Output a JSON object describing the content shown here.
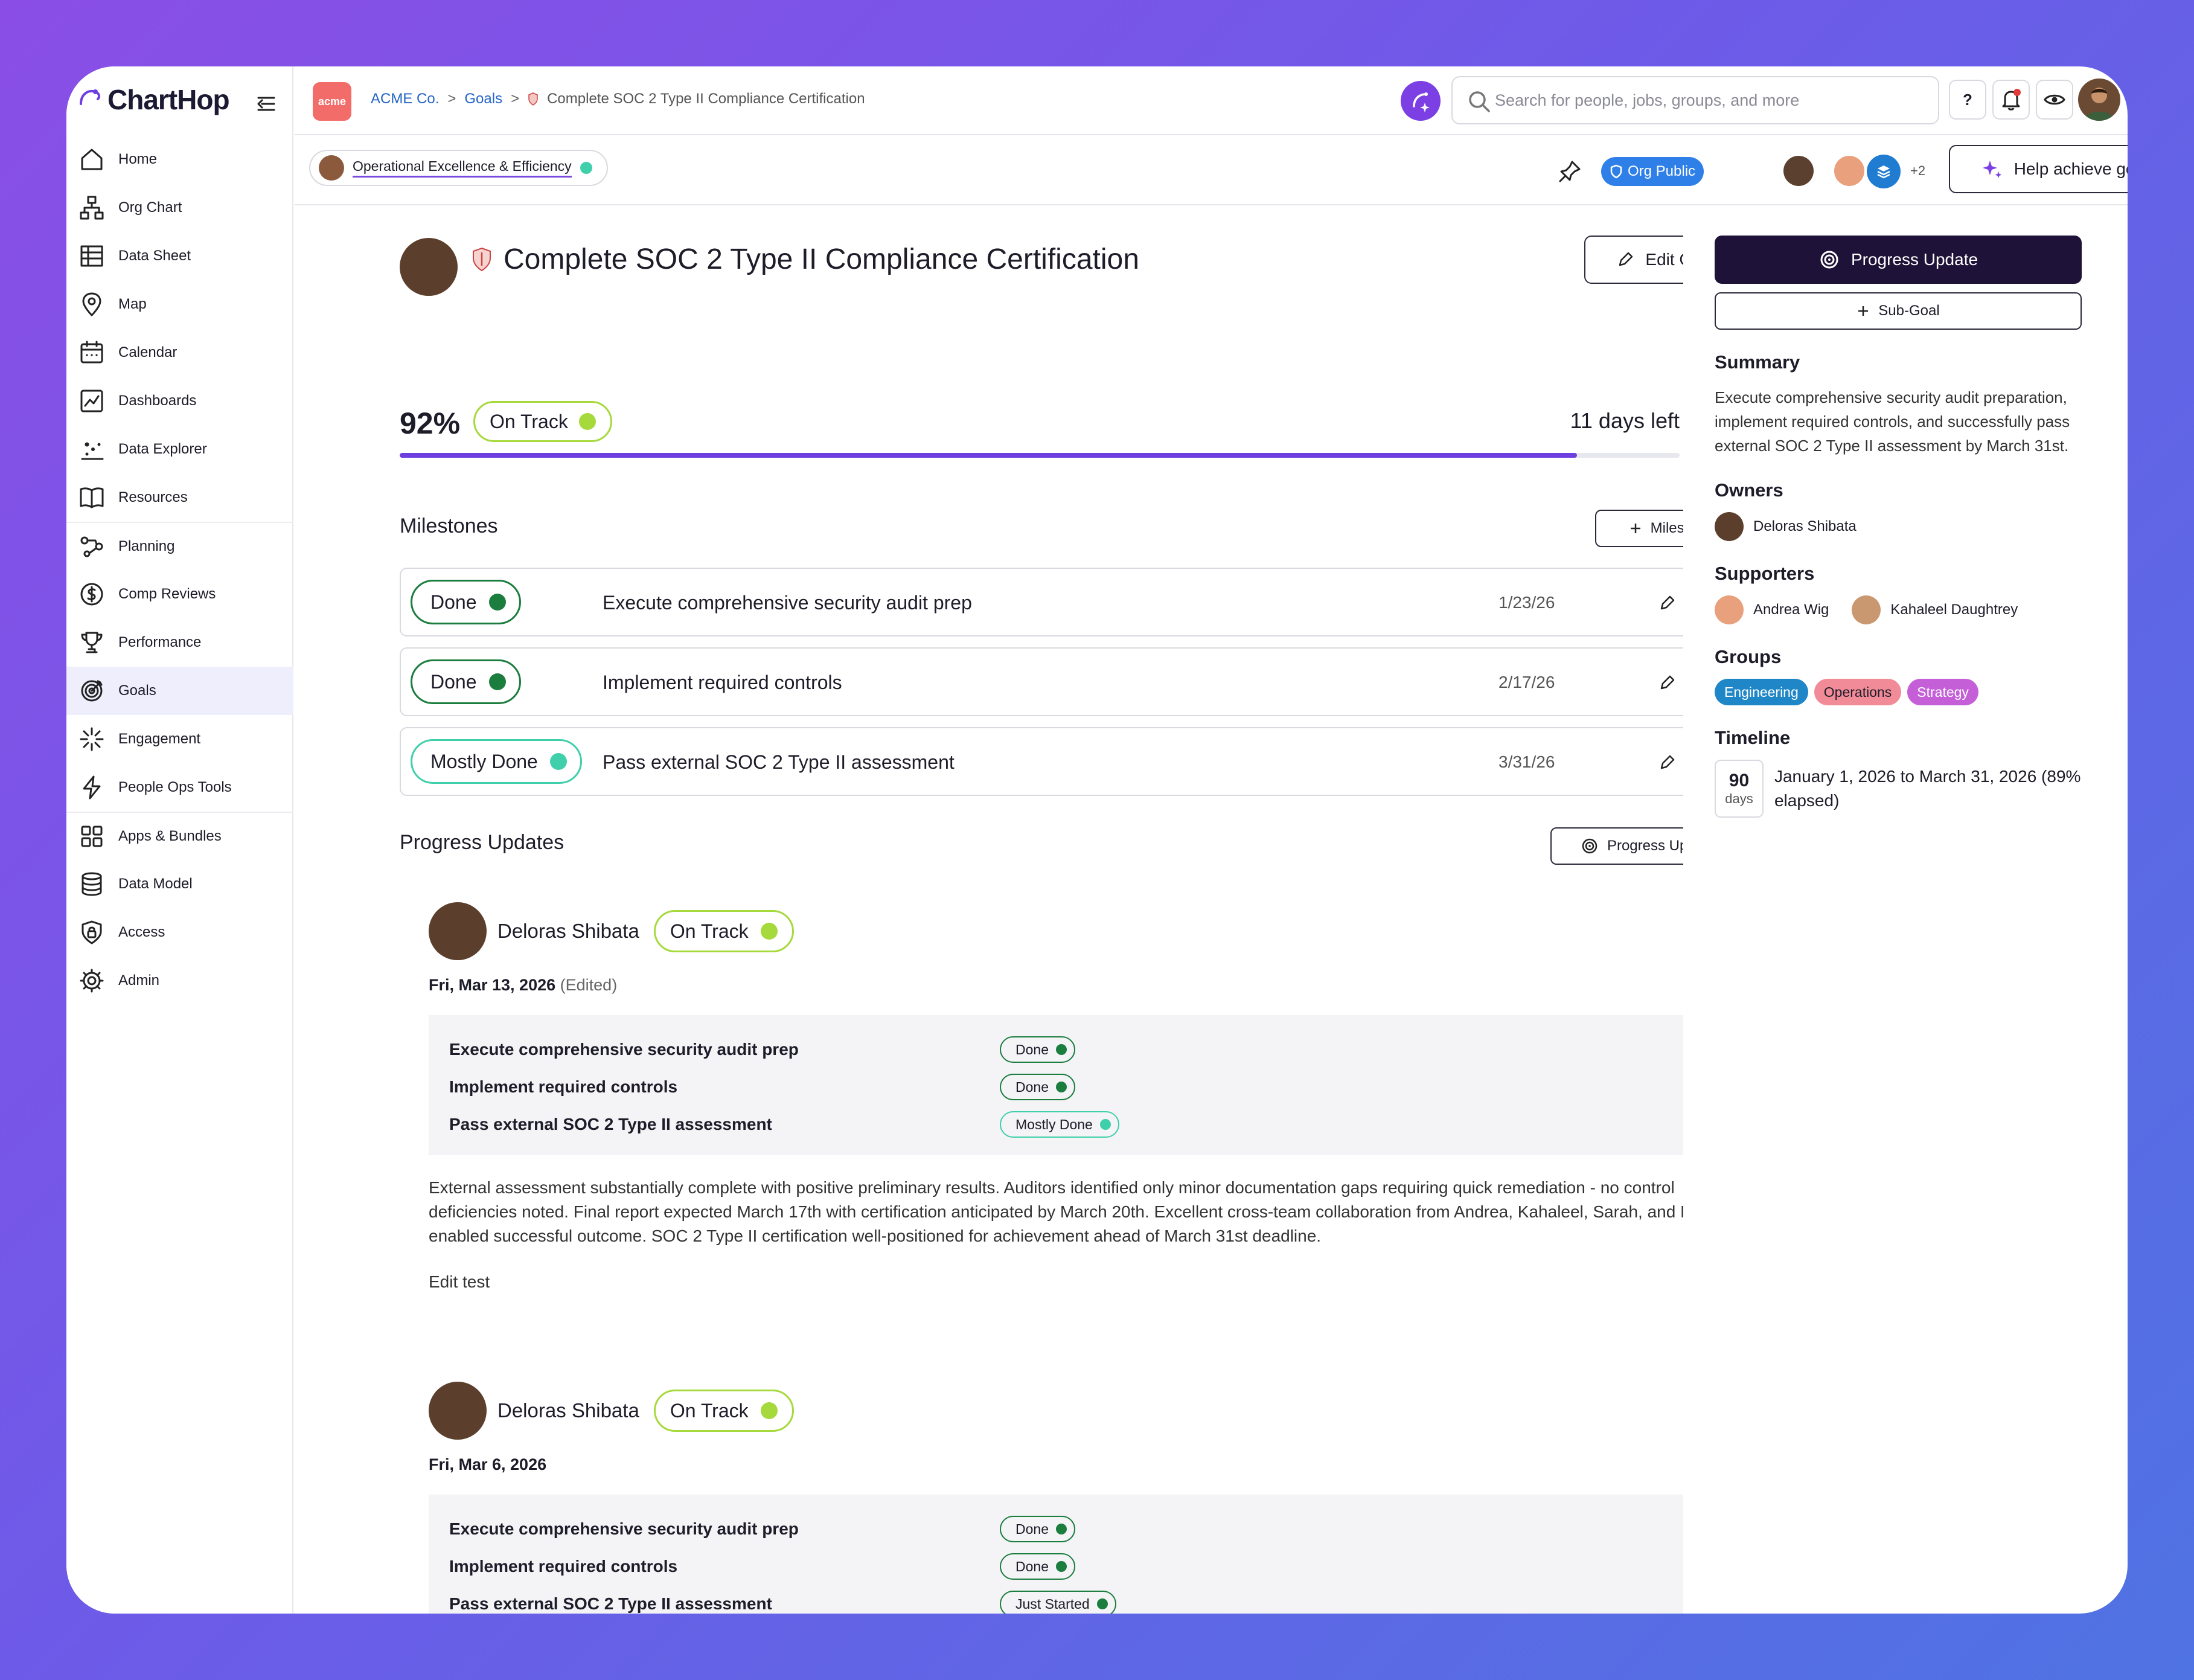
{
  "app": {
    "logo_text": "ChartHop"
  },
  "nav": [
    {
      "id": "home",
      "label": "Home",
      "icon": "home-icon"
    },
    {
      "id": "org-chart",
      "label": "Org Chart",
      "icon": "org-chart-icon"
    },
    {
      "id": "data-sheet",
      "label": "Data Sheet",
      "icon": "table-icon"
    },
    {
      "id": "map",
      "label": "Map",
      "icon": "map-pin-icon"
    },
    {
      "id": "calendar",
      "label": "Calendar",
      "icon": "calendar-icon"
    },
    {
      "id": "dashboards",
      "label": "Dashboards",
      "icon": "dashboard-chart-icon"
    },
    {
      "id": "data-explorer",
      "label": "Data Explorer",
      "icon": "scatter-icon"
    },
    {
      "id": "resources",
      "label": "Resources",
      "icon": "book-icon"
    },
    {
      "id": "planning",
      "label": "Planning",
      "icon": "planning-icon"
    },
    {
      "id": "comp-reviews",
      "label": "Comp Reviews",
      "icon": "dollar-icon"
    },
    {
      "id": "performance",
      "label": "Performance",
      "icon": "trophy-icon"
    },
    {
      "id": "goals",
      "label": "Goals",
      "icon": "target-icon"
    },
    {
      "id": "engagement",
      "label": "Engagement",
      "icon": "sparkle-burst-icon"
    },
    {
      "id": "people-ops-tools",
      "label": "People Ops Tools",
      "icon": "lightning-icon"
    },
    {
      "id": "apps-bundles",
      "label": "Apps & Bundles",
      "icon": "apps-grid-icon"
    },
    {
      "id": "data-model",
      "label": "Data Model",
      "icon": "database-icon"
    },
    {
      "id": "access",
      "label": "Access",
      "icon": "shield-lock-icon"
    },
    {
      "id": "admin",
      "label": "Admin",
      "icon": "gear-icon"
    }
  ],
  "topbar": {
    "org_logo": "acme",
    "breadcrumb": [
      "ACME Co.",
      "Goals",
      "Complete SOC 2 Type II Compliance Certification"
    ],
    "breadcrumb_sep": ">",
    "search_placeholder": "Search for people, jobs, groups, and more",
    "help_label": "?"
  },
  "subbar": {
    "parent_goal": "Operational Excellence & Efficiency",
    "visibility": "Org Public",
    "extra_count": "+2",
    "help_button": "Help achieve goal"
  },
  "goal": {
    "title": "Complete SOC 2 Type II Compliance Certification",
    "edit_label": "Edit Goal",
    "progress_pct": "92%",
    "progress_value": 0.92,
    "status": "On Track",
    "days_left": "11 days left",
    "colors": {
      "on_track": "#a6d93c",
      "done": "#1b7d3e",
      "mostly_done": "#3fcfaa",
      "progress": "#6d3fe0"
    }
  },
  "milestones": {
    "title": "Milestones",
    "add_label": "Milestone",
    "items": [
      {
        "status": "Done",
        "name": "Execute comprehensive security audit prep",
        "date": "1/23/26"
      },
      {
        "status": "Done",
        "name": "Implement required controls",
        "date": "2/17/26"
      },
      {
        "status": "Mostly Done",
        "name": "Pass external SOC 2 Type II assessment",
        "date": "3/31/26"
      }
    ]
  },
  "updates": {
    "title": "Progress Updates",
    "add_label": "Progress Update",
    "items": [
      {
        "author": "Deloras Shibata",
        "status": "On Track",
        "date": "Fri, Mar 13, 2026",
        "edited": "(Edited)",
        "lines": [
          {
            "label": "Execute comprehensive security audit prep",
            "status": "Done"
          },
          {
            "label": "Implement required controls",
            "status": "Done"
          },
          {
            "label": "Pass external SOC 2 Type II assessment",
            "status": "Mostly Done"
          }
        ],
        "text": "External assessment substantially complete with positive preliminary results. Auditors identified only minor documentation gaps requiring quick remediation - no control deficiencies noted. Final report expected March 17th with certification anticipated by March 20th. Excellent cross-team collaboration from Andrea, Kahaleel, Sarah, and Mike enabled successful outcome. SOC 2 Type II certification well-positioned for achievement ahead of March 31st deadline.",
        "extra": "Edit test"
      },
      {
        "author": "Deloras Shibata",
        "status": "On Track",
        "date": "Fri, Mar 6, 2026",
        "lines": [
          {
            "label": "Execute comprehensive security audit prep",
            "status": "Done"
          },
          {
            "label": "Implement required controls",
            "status": "Done"
          },
          {
            "label": "Pass external SOC 2 Type II assessment",
            "status": "Just Started"
          }
        ]
      }
    ]
  },
  "right": {
    "progress_update": "Progress Update",
    "sub_goal": "Sub-Goal",
    "summary_title": "Summary",
    "summary": "Execute comprehensive security audit preparation, implement required controls, and successfully pass external SOC 2 Type II assessment by March 31st.",
    "owners_title": "Owners",
    "owners": [
      "Deloras Shibata"
    ],
    "supporters_title": "Supporters",
    "supporters": [
      "Andrea Wig",
      "Kahaleel Daughtrey"
    ],
    "groups_title": "Groups",
    "groups": [
      {
        "name": "Engineering",
        "color": "#1f86c7"
      },
      {
        "name": "Operations",
        "color": "#f28b98"
      },
      {
        "name": "Strategy",
        "color": "#c45fd8"
      }
    ],
    "timeline_title": "Timeline",
    "timeline_days": "90",
    "timeline_unit": "days",
    "timeline_text": "January 1, 2026 to March 31, 2026 (89% elapsed)"
  }
}
